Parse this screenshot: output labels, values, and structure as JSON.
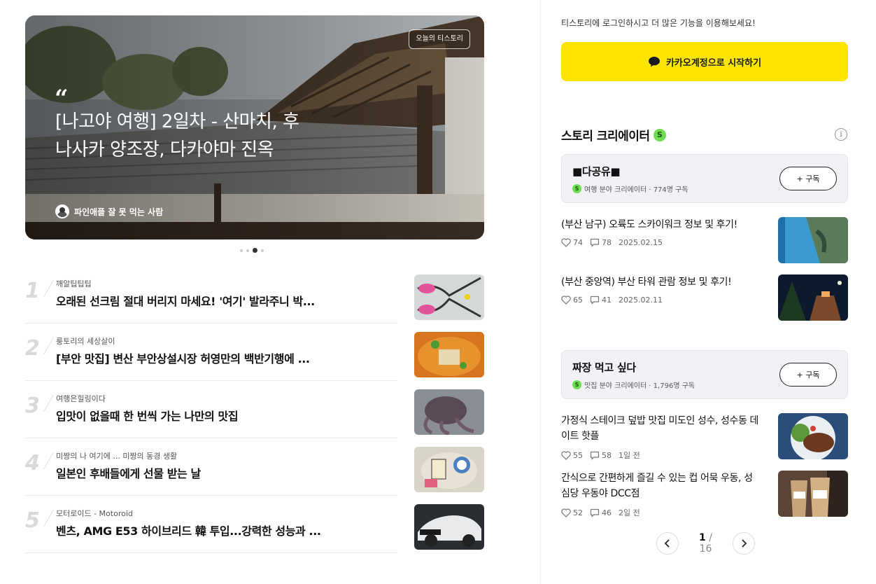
{
  "hero": {
    "badge": "오늘의 티스토리",
    "quote_mark": "“",
    "title": "[나고야 여행] 2일차 - 산마치, 후나사카 양조장, 다카야마 진옥",
    "author": "파인애플 잘 못 먹는 사람",
    "pagination": {
      "total": 4,
      "active": 3
    }
  },
  "ranking": [
    {
      "rank": "1",
      "blog": "깨알팁팁팁",
      "title": "오래된 선크림 절대 버리지 마세요! '여기' 발라주니 박...",
      "thumb": "scissors-photo"
    },
    {
      "rank": "2",
      "blog": "룽토리의 세상살이",
      "title": "[부안 맛집] 변산 부안상설시장 허영만의 백반기행에 ...",
      "thumb": "stew-photo"
    },
    {
      "rank": "3",
      "blog": "여행은힐링이다",
      "title": "입맛이 없을때 한 번씩 가는 나만의 맛집",
      "thumb": "octopus-photo"
    },
    {
      "rank": "4",
      "blog": "미짱의 나 여기에 ... 미짱의 동경 생활",
      "title": "일본인 후배들에게 선물 받는 날",
      "thumb": "gift-photo"
    },
    {
      "rank": "5",
      "blog": "모터로이드 - Motoroid",
      "title": "벤츠, AMG E53 하이브리드 韓 투입...강력한 성능과 ...",
      "thumb": "car-photo"
    }
  ],
  "login": {
    "text": "티스토리에 로그인하시고 더 많은 기능을 이용해보세요!",
    "kakao_label": "카카오계정으로 시작하기",
    "kakao_color": "#fee500"
  },
  "creators": {
    "heading": "스토리 크리에이터",
    "badge": "S",
    "items": [
      {
        "name": "■다공유■",
        "meta": "여행 분야 크리에이터 · 774명 구독",
        "subscribe": "+ 구독",
        "posts": [
          {
            "title": "(부산 남구) 오륙도 스카이워크 정보 및 후기!",
            "likes": "74",
            "comments": "78",
            "date": "2025.02.15",
            "thumb": "skywalk-photo"
          },
          {
            "title": "(부산 중앙역) 부산 타워 관람 정보 및 후기!",
            "likes": "65",
            "comments": "41",
            "date": "2025.02.11",
            "thumb": "tower-photo"
          }
        ]
      },
      {
        "name": "짜장 먹고 싶다",
        "meta": "맛집 분야 크리에이터 · 1,796명 구독",
        "subscribe": "+ 구독",
        "posts": [
          {
            "title": "가정식 스테이크 덮밥 맛집 미도인 성수, 성수동 데이트 핫플",
            "likes": "55",
            "comments": "58",
            "date": "1일 전",
            "thumb": "steak-photo"
          },
          {
            "title": "간식으로 간편하게 즐길 수 있는 컵 어묵 우동, 성심당 우동야 DCC점",
            "likes": "52",
            "comments": "46",
            "date": "2일 전",
            "thumb": "cups-photo"
          }
        ]
      }
    ]
  },
  "pager": {
    "current": "1",
    "separator": "/",
    "total": "16"
  }
}
